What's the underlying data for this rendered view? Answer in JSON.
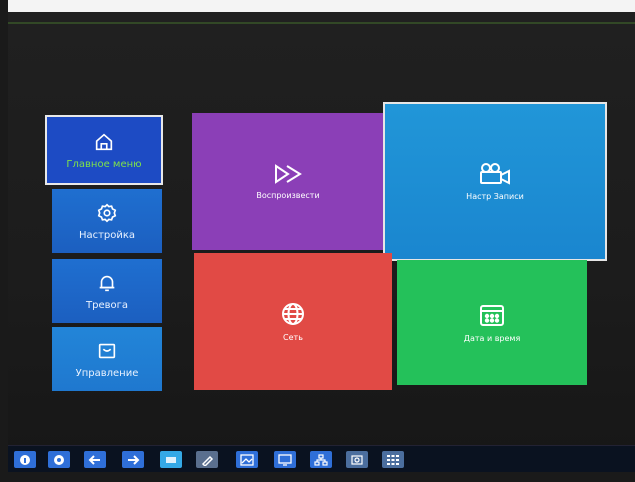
{
  "sidebar": {
    "items": [
      {
        "label": "Главное меню",
        "icon": "home-icon"
      },
      {
        "label": "Настройка",
        "icon": "gear-icon"
      },
      {
        "label": "Тревога",
        "icon": "bell-icon"
      },
      {
        "label": "Управление",
        "icon": "box-icon"
      }
    ]
  },
  "tiles": {
    "play": "Воспроизвести",
    "record": "Настр Записи",
    "network": "Сеть",
    "datetime": "Дата и время"
  },
  "taskbar_icons": [
    "info-icon",
    "pointer-icon",
    "arrow-left-icon",
    "arrow-right-icon",
    "screen-icon",
    "pen-icon",
    "image-icon",
    "monitor-icon",
    "network-icon",
    "camera-icon",
    "grid-icon"
  ],
  "colors": {
    "active_label": "#7ee24a",
    "play": "#8b3fb7",
    "record": "#1a86cf",
    "network": "#e14a45",
    "datetime": "#24c15a"
  }
}
